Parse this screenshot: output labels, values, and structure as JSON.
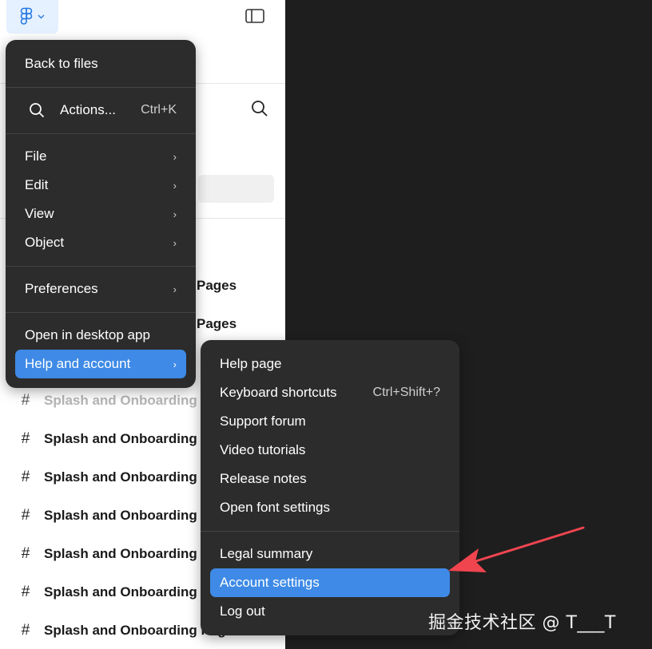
{
  "sidebar": {
    "pages_partial": [
      "Pages",
      "Pages"
    ],
    "rows": [
      {
        "label": "Splash and Onboarding P",
        "muted": true
      },
      {
        "label": "Splash and Onboarding P",
        "muted": false
      },
      {
        "label": "Splash and Onboarding P",
        "muted": false
      },
      {
        "label": "Splash and Onboarding P",
        "muted": false
      },
      {
        "label": "Splash and Onboarding P",
        "muted": false
      },
      {
        "label": "Splash and Onboarding P",
        "muted": false
      },
      {
        "label": "Splash and Onboarding Pag",
        "muted": false
      }
    ],
    "hash_glyph": "#"
  },
  "main_menu": {
    "back_to_files": "Back to files",
    "actions": {
      "label": "Actions...",
      "shortcut": "Ctrl+K"
    },
    "file": "File",
    "edit": "Edit",
    "view": "View",
    "object": "Object",
    "preferences": "Preferences",
    "open_desktop": "Open in desktop app",
    "help_account": "Help and account",
    "chevron": "›"
  },
  "sub_menu": {
    "help_page": "Help page",
    "keyboard_shortcuts": {
      "label": "Keyboard shortcuts",
      "shortcut": "Ctrl+Shift+?"
    },
    "support_forum": "Support forum",
    "video_tutorials": "Video tutorials",
    "release_notes": "Release notes",
    "open_font_settings": "Open font settings",
    "legal_summary": "Legal summary",
    "account_settings": "Account settings",
    "log_out": "Log out"
  },
  "watermark": "掘金技术社区 @ T___T",
  "colors": {
    "menu_bg": "#2c2c2c",
    "highlight": "#3e8ae6",
    "canvas": "#1e1e1e",
    "arrow": "#f0454f",
    "logo_bg": "#e5f1ff"
  },
  "icons": [
    "figma-logo-icon",
    "chevron-down-icon",
    "sidebar-toggle-icon",
    "search-icon",
    "hash-icon",
    "chevron-right-icon",
    "arrow-annotation-icon"
  ]
}
